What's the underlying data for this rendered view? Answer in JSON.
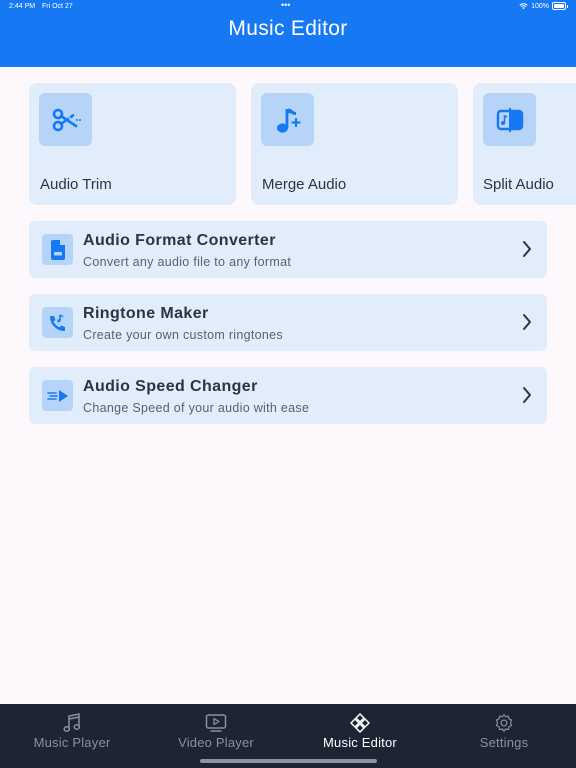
{
  "status_bar": {
    "time": "2:44 PM",
    "date": "Fri Oct 27",
    "dots": "•••",
    "battery": "100%"
  },
  "header": {
    "title": "Music Editor"
  },
  "cards": [
    {
      "label": "Audio Trim",
      "icon": "scissors-icon"
    },
    {
      "label": "Merge Audio",
      "icon": "music-note-plus-icon"
    },
    {
      "label": "Split Audio",
      "icon": "split-audio-icon"
    }
  ],
  "rows": [
    {
      "title": "Audio Format Converter",
      "subtitle": "Convert any audio file to any format",
      "icon": "audio-file-icon"
    },
    {
      "title": "Ringtone Maker",
      "subtitle": "Create your own custom ringtones",
      "icon": "phone-ring-icon"
    },
    {
      "title": "Audio Speed Changer",
      "subtitle": "Change Speed of your audio with ease",
      "icon": "speed-play-icon"
    }
  ],
  "tabs": [
    {
      "label": "Music Player",
      "icon": "music-note-icon",
      "active": false
    },
    {
      "label": "Video Player",
      "icon": "video-player-icon",
      "active": false
    },
    {
      "label": "Music Editor",
      "icon": "music-editor-icon",
      "active": true
    },
    {
      "label": "Settings",
      "icon": "gear-icon",
      "active": false
    }
  ],
  "colors": {
    "header": "#1679f3",
    "accent": "#1679f3",
    "card_bg": "#e1edfb",
    "icon_bg": "#b5d4f8",
    "tabbar_bg": "#1d2434",
    "page_bg": "#fcf8fc"
  }
}
